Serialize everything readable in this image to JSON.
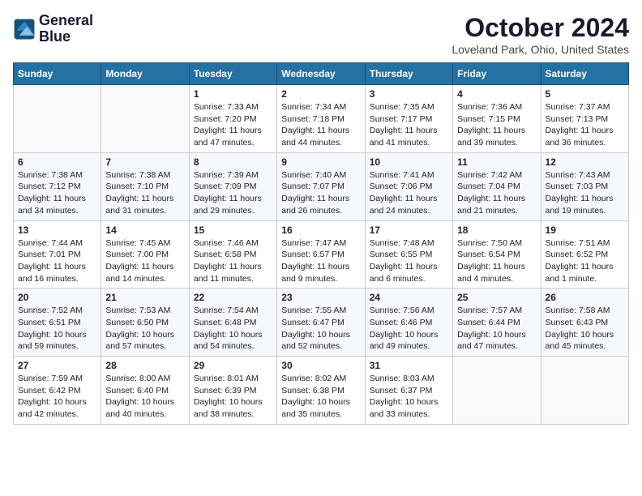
{
  "logo": {
    "line1": "General",
    "line2": "Blue"
  },
  "title": "October 2024",
  "location": "Loveland Park, Ohio, United States",
  "weekdays": [
    "Sunday",
    "Monday",
    "Tuesday",
    "Wednesday",
    "Thursday",
    "Friday",
    "Saturday"
  ],
  "weeks": [
    [
      {
        "day": "",
        "info": ""
      },
      {
        "day": "",
        "info": ""
      },
      {
        "day": "1",
        "sunrise": "7:33 AM",
        "sunset": "7:20 PM",
        "daylight": "11 hours and 47 minutes."
      },
      {
        "day": "2",
        "sunrise": "7:34 AM",
        "sunset": "7:18 PM",
        "daylight": "11 hours and 44 minutes."
      },
      {
        "day": "3",
        "sunrise": "7:35 AM",
        "sunset": "7:17 PM",
        "daylight": "11 hours and 41 minutes."
      },
      {
        "day": "4",
        "sunrise": "7:36 AM",
        "sunset": "7:15 PM",
        "daylight": "11 hours and 39 minutes."
      },
      {
        "day": "5",
        "sunrise": "7:37 AM",
        "sunset": "7:13 PM",
        "daylight": "11 hours and 36 minutes."
      }
    ],
    [
      {
        "day": "6",
        "sunrise": "7:38 AM",
        "sunset": "7:12 PM",
        "daylight": "11 hours and 34 minutes."
      },
      {
        "day": "7",
        "sunrise": "7:38 AM",
        "sunset": "7:10 PM",
        "daylight": "11 hours and 31 minutes."
      },
      {
        "day": "8",
        "sunrise": "7:39 AM",
        "sunset": "7:09 PM",
        "daylight": "11 hours and 29 minutes."
      },
      {
        "day": "9",
        "sunrise": "7:40 AM",
        "sunset": "7:07 PM",
        "daylight": "11 hours and 26 minutes."
      },
      {
        "day": "10",
        "sunrise": "7:41 AM",
        "sunset": "7:06 PM",
        "daylight": "11 hours and 24 minutes."
      },
      {
        "day": "11",
        "sunrise": "7:42 AM",
        "sunset": "7:04 PM",
        "daylight": "11 hours and 21 minutes."
      },
      {
        "day": "12",
        "sunrise": "7:43 AM",
        "sunset": "7:03 PM",
        "daylight": "11 hours and 19 minutes."
      }
    ],
    [
      {
        "day": "13",
        "sunrise": "7:44 AM",
        "sunset": "7:01 PM",
        "daylight": "11 hours and 16 minutes."
      },
      {
        "day": "14",
        "sunrise": "7:45 AM",
        "sunset": "7:00 PM",
        "daylight": "11 hours and 14 minutes."
      },
      {
        "day": "15",
        "sunrise": "7:46 AM",
        "sunset": "6:58 PM",
        "daylight": "11 hours and 11 minutes."
      },
      {
        "day": "16",
        "sunrise": "7:47 AM",
        "sunset": "6:57 PM",
        "daylight": "11 hours and 9 minutes."
      },
      {
        "day": "17",
        "sunrise": "7:48 AM",
        "sunset": "6:55 PM",
        "daylight": "11 hours and 6 minutes."
      },
      {
        "day": "18",
        "sunrise": "7:50 AM",
        "sunset": "6:54 PM",
        "daylight": "11 hours and 4 minutes."
      },
      {
        "day": "19",
        "sunrise": "7:51 AM",
        "sunset": "6:52 PM",
        "daylight": "11 hours and 1 minute."
      }
    ],
    [
      {
        "day": "20",
        "sunrise": "7:52 AM",
        "sunset": "6:51 PM",
        "daylight": "10 hours and 59 minutes."
      },
      {
        "day": "21",
        "sunrise": "7:53 AM",
        "sunset": "6:50 PM",
        "daylight": "10 hours and 57 minutes."
      },
      {
        "day": "22",
        "sunrise": "7:54 AM",
        "sunset": "6:48 PM",
        "daylight": "10 hours and 54 minutes."
      },
      {
        "day": "23",
        "sunrise": "7:55 AM",
        "sunset": "6:47 PM",
        "daylight": "10 hours and 52 minutes."
      },
      {
        "day": "24",
        "sunrise": "7:56 AM",
        "sunset": "6:46 PM",
        "daylight": "10 hours and 49 minutes."
      },
      {
        "day": "25",
        "sunrise": "7:57 AM",
        "sunset": "6:44 PM",
        "daylight": "10 hours and 47 minutes."
      },
      {
        "day": "26",
        "sunrise": "7:58 AM",
        "sunset": "6:43 PM",
        "daylight": "10 hours and 45 minutes."
      }
    ],
    [
      {
        "day": "27",
        "sunrise": "7:59 AM",
        "sunset": "6:42 PM",
        "daylight": "10 hours and 42 minutes."
      },
      {
        "day": "28",
        "sunrise": "8:00 AM",
        "sunset": "6:40 PM",
        "daylight": "10 hours and 40 minutes."
      },
      {
        "day": "29",
        "sunrise": "8:01 AM",
        "sunset": "6:39 PM",
        "daylight": "10 hours and 38 minutes."
      },
      {
        "day": "30",
        "sunrise": "8:02 AM",
        "sunset": "6:38 PM",
        "daylight": "10 hours and 35 minutes."
      },
      {
        "day": "31",
        "sunrise": "8:03 AM",
        "sunset": "6:37 PM",
        "daylight": "10 hours and 33 minutes."
      },
      {
        "day": "",
        "info": ""
      },
      {
        "day": "",
        "info": ""
      }
    ]
  ]
}
